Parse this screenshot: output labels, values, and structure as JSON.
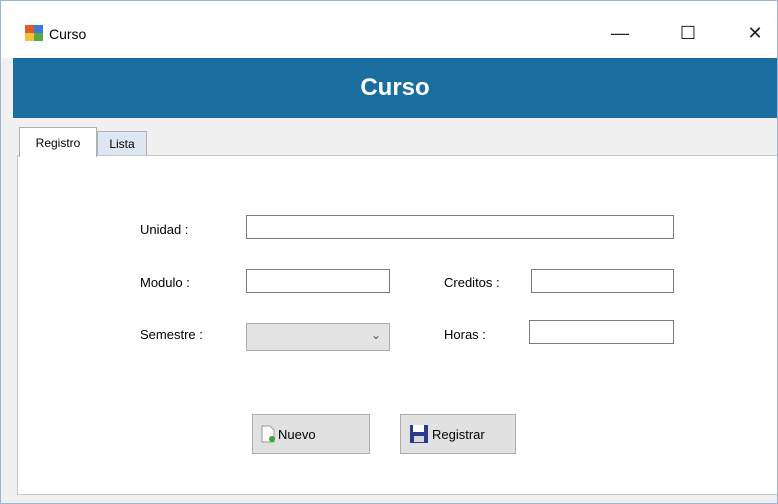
{
  "window": {
    "title": "Curso",
    "minimize": "—",
    "maximize": "☐",
    "close": "✕"
  },
  "header": {
    "title": "Curso"
  },
  "tabs": [
    {
      "label": "Registro"
    },
    {
      "label": "Lista"
    }
  ],
  "form": {
    "unidad": {
      "label": "Unidad :",
      "value": ""
    },
    "modulo": {
      "label": "Modulo :",
      "value": ""
    },
    "creditos": {
      "label": "Creditos :",
      "value": ""
    },
    "semestre": {
      "label": "Semestre :",
      "value": ""
    },
    "horas": {
      "label": "Horas :",
      "value": ""
    }
  },
  "buttons": {
    "nuevo": "Nuevo",
    "registrar": "Registrar"
  },
  "icons": {
    "app": "form-app-icon",
    "nuevo": "new-document-icon",
    "registrar": "floppy-disk-icon"
  },
  "colors": {
    "header_bg": "#1a6e9f",
    "tab_inactive": "#dde7f4"
  }
}
